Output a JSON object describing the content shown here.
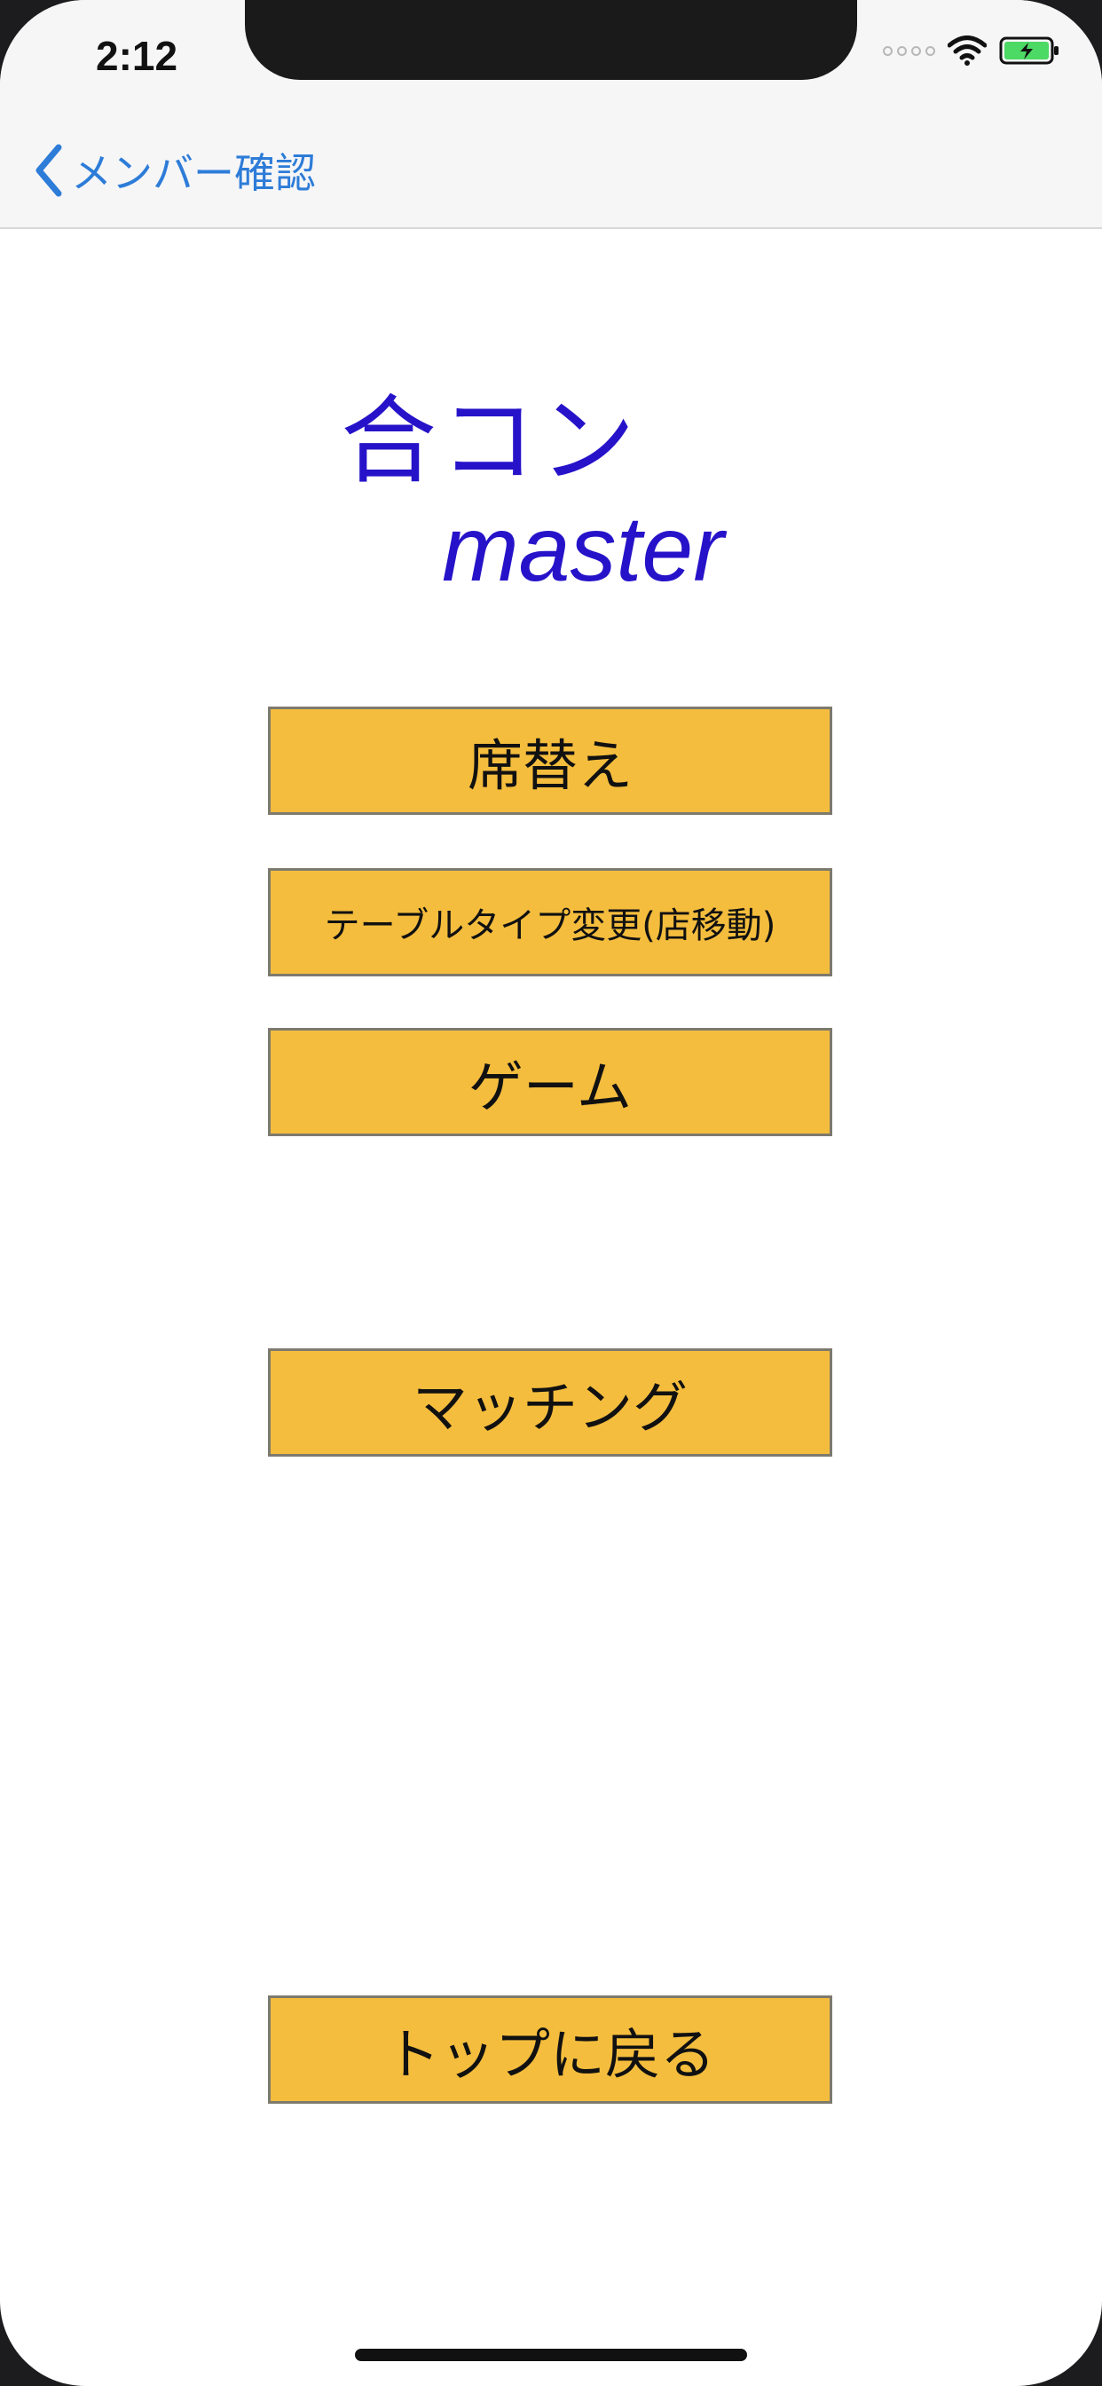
{
  "status_bar": {
    "time": "2:12"
  },
  "nav": {
    "back_label": "メンバー確認"
  },
  "logo": {
    "line1": "合コン",
    "line2": "master"
  },
  "buttons": {
    "seat_change": "席替え",
    "table_type": "テーブルタイプ変更(店移動)",
    "game": "ゲーム",
    "matching": "マッチング",
    "back_to_top": "トップに戻る"
  },
  "icons": {
    "back": "chevron-left-icon",
    "wifi": "wifi-icon",
    "battery": "battery-charging-icon",
    "signal": "cellular-signal-icon"
  },
  "colors": {
    "accent_blue": "#2d7cd8",
    "logo_color": "#2613c9",
    "button_fill": "#f4bd3d",
    "battery_green": "#4cd964"
  }
}
